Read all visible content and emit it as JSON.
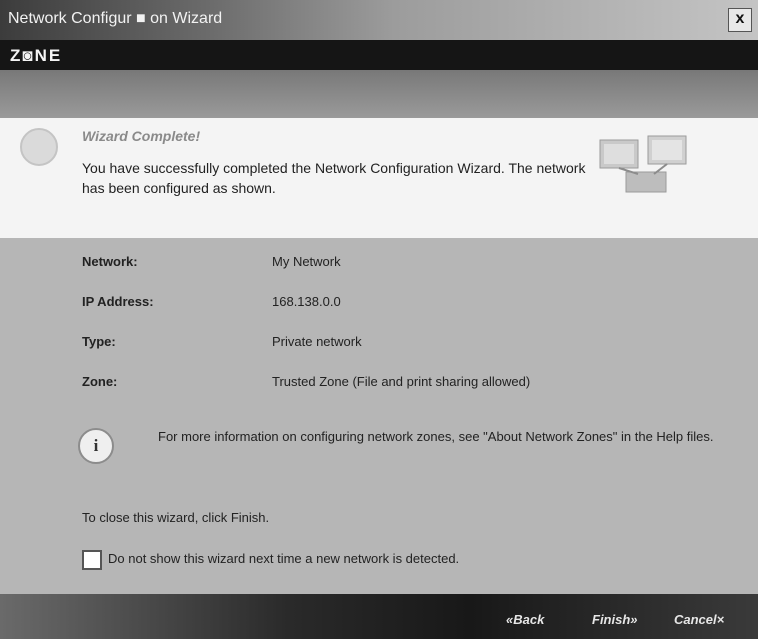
{
  "window": {
    "title": "Network Configur ■ on Wizard",
    "close_label": "x",
    "logo": "Z◙NE"
  },
  "header": {
    "title": "Wizard Complete!",
    "description": "You have successfully completed the Network Configuration Wizard.  The network has been configured as shown."
  },
  "details": {
    "network_label": "Network:",
    "network_value": "My Network",
    "ip_label": "IP Address:",
    "ip_value": "168.138.0.0",
    "type_label": "Type:",
    "type_value": "Private network",
    "zone_label": "Zone:",
    "zone_value": "Trusted Zone (File and print sharing allowed)"
  },
  "info": {
    "text": "For more information on configuring network zones, see \"About Network Zones\" in the Help files."
  },
  "close_note": "To close this wizard, click Finish.",
  "checkbox": {
    "label": "Do not show this wizard next time a new network is detected.",
    "checked": false
  },
  "buttons": {
    "back": "«Back",
    "finish": "Finish»",
    "cancel": "Cancel×"
  }
}
